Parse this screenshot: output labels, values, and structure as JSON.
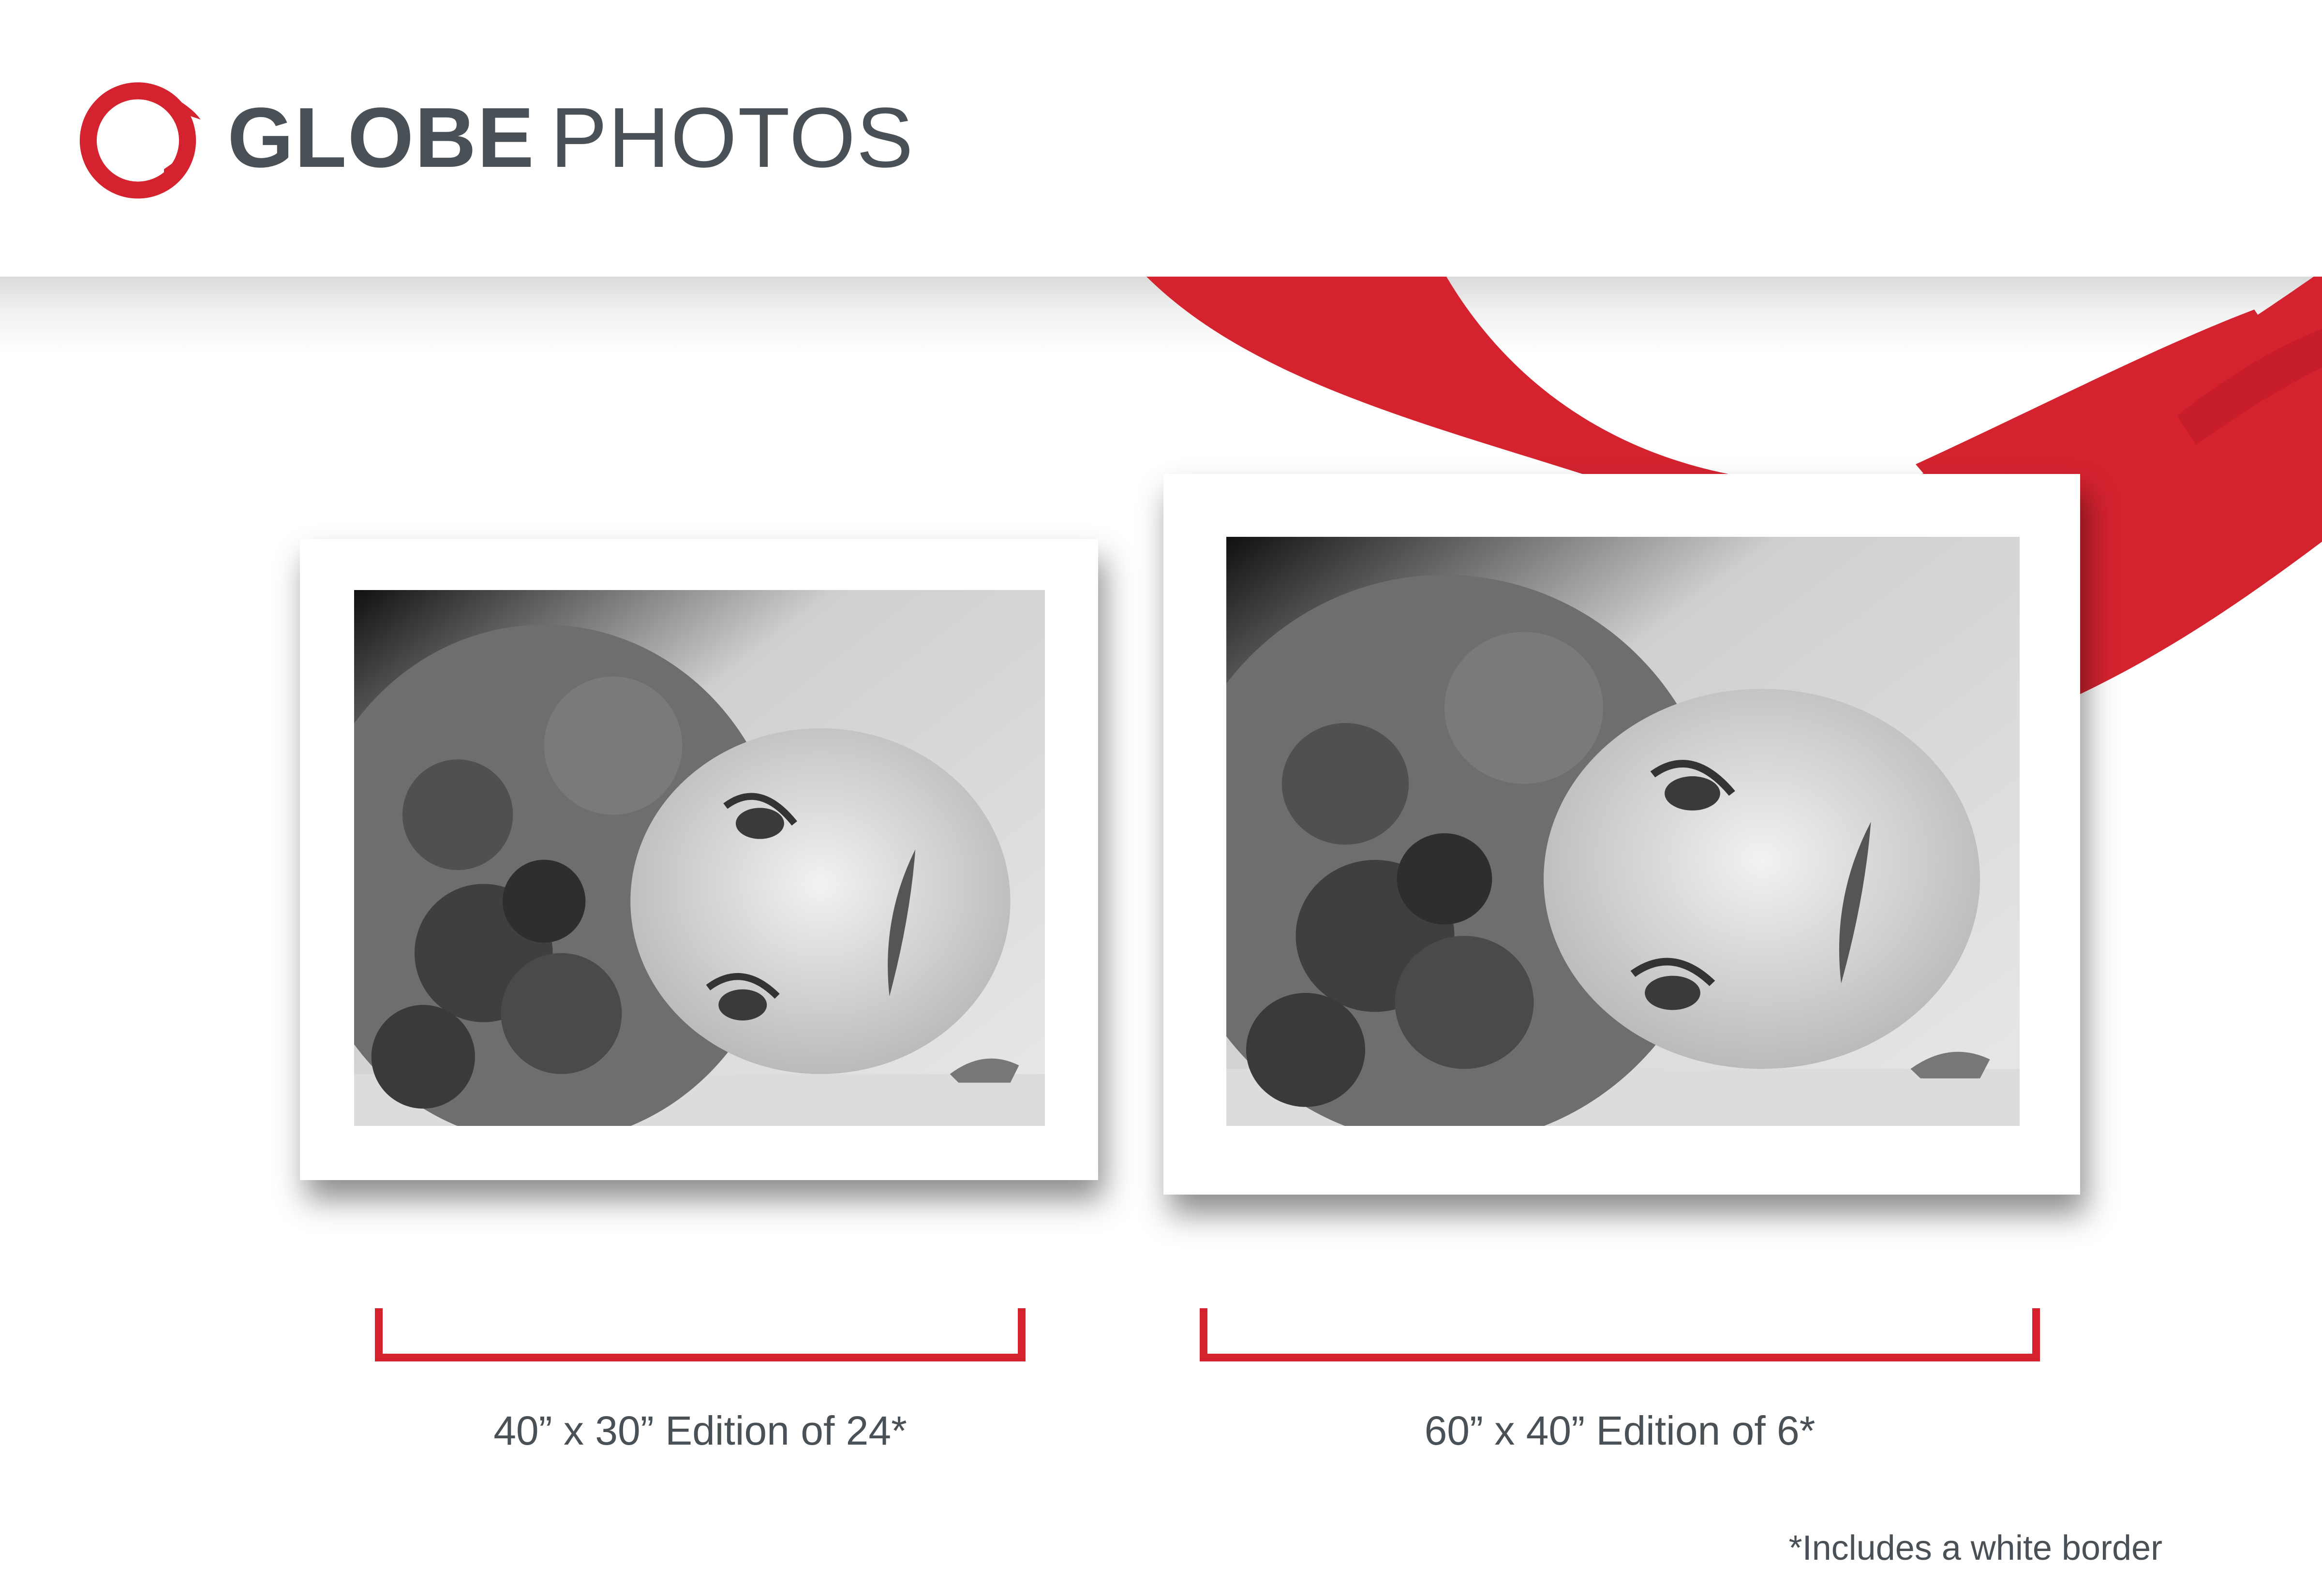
{
  "brand": {
    "name_bold": "GLOBE",
    "name_light": "PHOTOS",
    "accent_color": "#d4232f",
    "text_color": "#4a5156"
  },
  "editions": [
    {
      "size": "40” x 30”",
      "edition": "Edition of 24*"
    },
    {
      "size": "60” x 40”",
      "edition": "Edition of 6*"
    }
  ],
  "footnote": "*Includes a white border"
}
